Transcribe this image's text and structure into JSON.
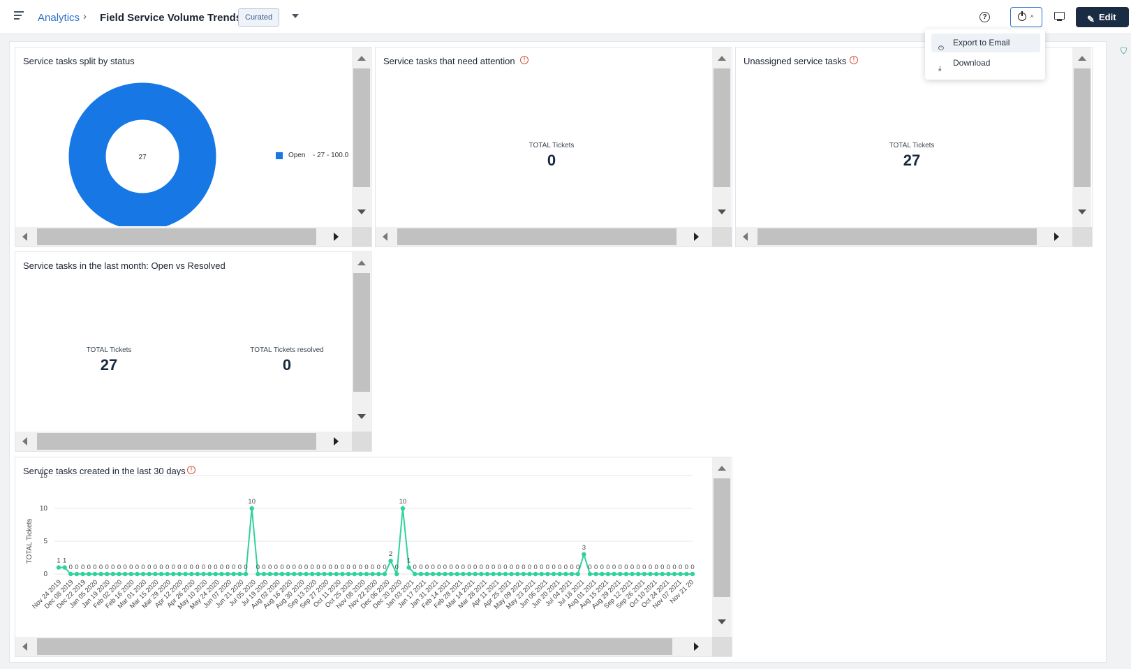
{
  "header": {
    "menu_icon": "hamburger-icon",
    "breadcrumb": "Analytics",
    "breadcrumb_sep": "›",
    "title": "Field Service Volume Trends",
    "badge": "Curated",
    "help_icon": "?",
    "edit_label": "Edit"
  },
  "export_menu": {
    "items": [
      {
        "label": "Export to Email",
        "icon": "export-icon"
      },
      {
        "label": "Download",
        "icon": "download-icon"
      }
    ]
  },
  "panels": {
    "status_split": {
      "title": "Service tasks split by status",
      "center_value": "27",
      "legend_label": "Open",
      "legend_value": "- 27 - 100.0",
      "color": "#1677e5"
    },
    "attention": {
      "title": "Service tasks that need attention",
      "kpi_label": "TOTAL Tickets",
      "kpi_value": "0"
    },
    "unassigned": {
      "title": "Unassigned service tasks",
      "kpi_label": "TOTAL Tickets",
      "kpi_value": "27"
    },
    "last_month": {
      "title": "Service tasks in the last month: Open vs Resolved",
      "kpi1_label": "TOTAL Tickets",
      "kpi1_value": "27",
      "kpi2_label": "TOTAL Tickets resolved",
      "kpi2_value": "0"
    },
    "created_30": {
      "title": "Service tasks created in the last 30 days"
    }
  },
  "chart_data": {
    "type": "line",
    "title": "Service tasks created in the last 30 days",
    "ylabel": "TOTAL Tickets",
    "ylim": [
      0,
      15
    ],
    "yticks": [
      0,
      5,
      10,
      15
    ],
    "line_color": "#2fd39a",
    "x_labels": [
      "Nov 24 2019",
      "Dec 08 2019",
      "Dec 22 2019",
      "Jan 05 2020",
      "Jan 19 2020",
      "Feb 02 2020",
      "Feb 16 2020",
      "Mar 01 2020",
      "Mar 15 2020",
      "Mar 29 2020",
      "Apr 12 2020",
      "Apr 26 2020",
      "May 10 2020",
      "May 24 2020",
      "Jun 07 2020",
      "Jun 21 2020",
      "Jul 05 2020",
      "Jul 19 2020",
      "Aug 02 2020",
      "Aug 16 2020",
      "Aug 30 2020",
      "Sep 13 2020",
      "Sep 27 2020",
      "Oct 11 2020",
      "Oct 25 2020",
      "Nov 08 2020",
      "Nov 22 2020",
      "Dec 06 2020",
      "Dec 20 2020",
      "Jan 03 2021",
      "Jan 17 2021",
      "Jan 31 2021",
      "Feb 14 2021",
      "Feb 28 2021",
      "Mar 14 2021",
      "Mar 28 2021",
      "Apr 11 2021",
      "Apr 25 2021",
      "May 09 2021",
      "May 23 2021",
      "Jun 06 2021",
      "Jun 20 2021",
      "Jul 04 2021",
      "Jul 18 2021",
      "Aug 01 2021",
      "Aug 15 2021",
      "Aug 29 2021",
      "Sep 12 2021",
      "Sep 26 2021",
      "Oct 10 2021",
      "Oct 24 2021",
      "Nov 07 2021",
      "Nov 21 20"
    ],
    "values": [
      1,
      1,
      0,
      0,
      0,
      0,
      0,
      0,
      0,
      0,
      0,
      0,
      0,
      0,
      0,
      0,
      0,
      0,
      0,
      0,
      0,
      0,
      0,
      0,
      0,
      0,
      0,
      0,
      0,
      0,
      0,
      0,
      10,
      0,
      0,
      0,
      0,
      0,
      0,
      0,
      0,
      0,
      0,
      0,
      0,
      0,
      0,
      0,
      0,
      0,
      0,
      0,
      0,
      0,
      0,
      2,
      0,
      10,
      1,
      0,
      0,
      0,
      0,
      0,
      0,
      0,
      0,
      0,
      0,
      0,
      0,
      0,
      0,
      0,
      0,
      0,
      0,
      0,
      0,
      0,
      0,
      0,
      0,
      0,
      0,
      0,
      0,
      3,
      0,
      0,
      0,
      0,
      0,
      0,
      0,
      0,
      0,
      0,
      0,
      0,
      0,
      0,
      0,
      0,
      0,
      0
    ]
  }
}
